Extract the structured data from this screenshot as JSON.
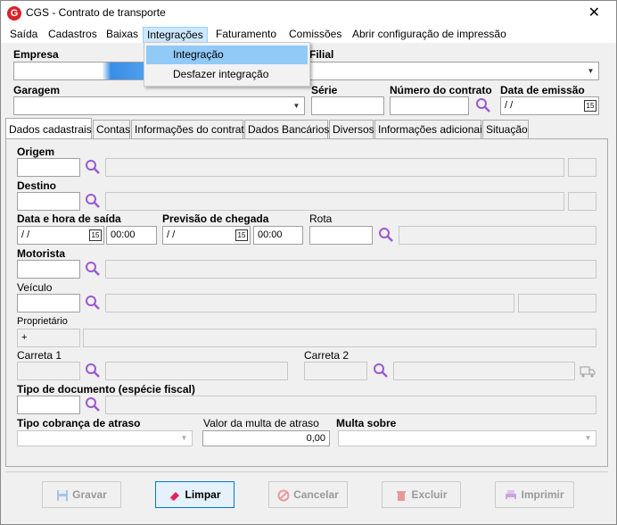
{
  "window": {
    "title": "CGS - Contrato de transporte",
    "close_label": "✕"
  },
  "menu": {
    "items": [
      "Saída",
      "Cadastros",
      "Baixas",
      "Integrações",
      "Faturamento",
      "Comissões",
      "Abrir configuração de impressão"
    ],
    "active": "Integrações",
    "dropdown": [
      "Integração",
      "Desfazer integração"
    ]
  },
  "header": {
    "empresa_label": "Empresa",
    "filial_label": "Filial",
    "garagem_label": "Garagem",
    "serie_label": "Série",
    "numero_label": "Número do contrato",
    "data_emissao_label": "Data de emissão",
    "data_emissao_value": " / /"
  },
  "tabs": [
    "Dados cadastrais",
    "Contas",
    "Informações do contrato",
    "Dados Bancários",
    "Diversos",
    "Informações adicionais",
    "Situação"
  ],
  "form": {
    "origem_label": "Origem",
    "destino_label": "Destino",
    "data_saida_label": "Data e hora de saída",
    "data_saida_value": " / /",
    "hora_saida_value": "00:00",
    "previsao_label": "Previsão de chegada",
    "previsao_value": " / /",
    "hora_chegada_value": "00:00",
    "rota_label": "Rota",
    "motorista_label": "Motorista",
    "veiculo_label": "Veículo",
    "proprietario_label": "Proprietário",
    "proprietario_value": "+",
    "carreta1_label": "Carreta 1",
    "carreta2_label": "Carreta 2",
    "tipo_doc_label": "Tipo de documento (espécie fiscal)",
    "tipo_cobranca_label": "Tipo cobrança de atraso",
    "valor_multa_label": "Valor da multa de atraso",
    "valor_multa_value": "0,00",
    "multa_sobre_label": "Multa sobre"
  },
  "buttons": {
    "gravar": "Gravar",
    "limpar": "Limpar",
    "cancelar": "Cancelar",
    "excluir": "Excluir",
    "imprimir": "Imprimir"
  },
  "colors": {
    "search_icon": "#9b59d0",
    "accent": "#0078d7",
    "menu_highlight": "#91c9f7"
  }
}
